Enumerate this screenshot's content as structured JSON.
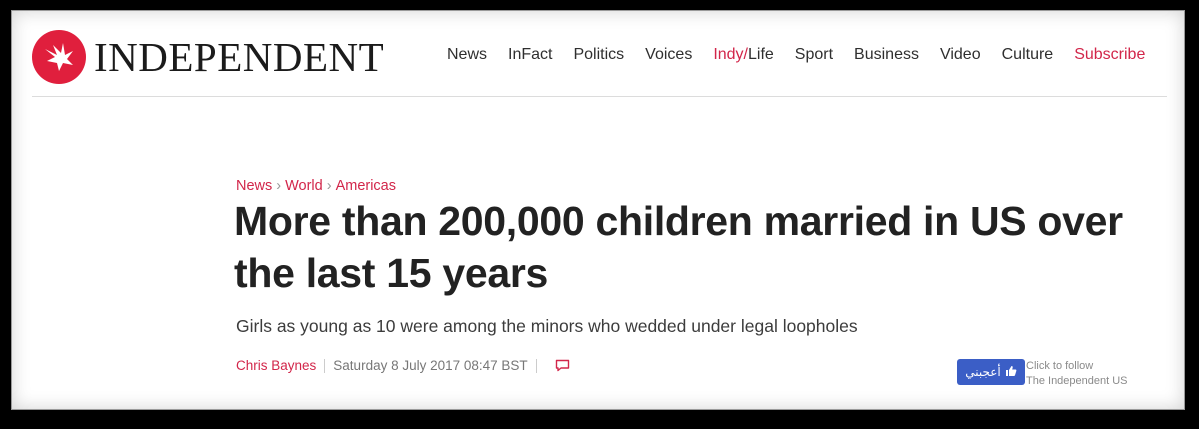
{
  "brand": {
    "name": "INDEPENDENT"
  },
  "nav": {
    "items": [
      "News",
      "InFact",
      "Politics",
      "Voices"
    ],
    "indy_prefix": "Indy/",
    "indy_suffix": "Life",
    "items_after": [
      "Sport",
      "Business",
      "Video",
      "Culture"
    ],
    "subscribe": "Subscribe"
  },
  "breadcrumb": {
    "items": [
      "News",
      "World",
      "Americas"
    ],
    "separator": "›"
  },
  "article": {
    "headline": "More than 200,000 children married in US over the last 15 years",
    "subheadline": "Girls as young as 10 were among the minors who wedded under legal loopholes",
    "author": "Chris Baynes",
    "date": "Saturday 8 July 2017 08:47 BST"
  },
  "social": {
    "like_label": "أعجبني",
    "follow_line1": "Click to follow",
    "follow_line2": "The Independent US"
  },
  "colors": {
    "accent": "#d2264a",
    "logo_red": "#e01f3d",
    "facebook": "#3b5ec6"
  }
}
